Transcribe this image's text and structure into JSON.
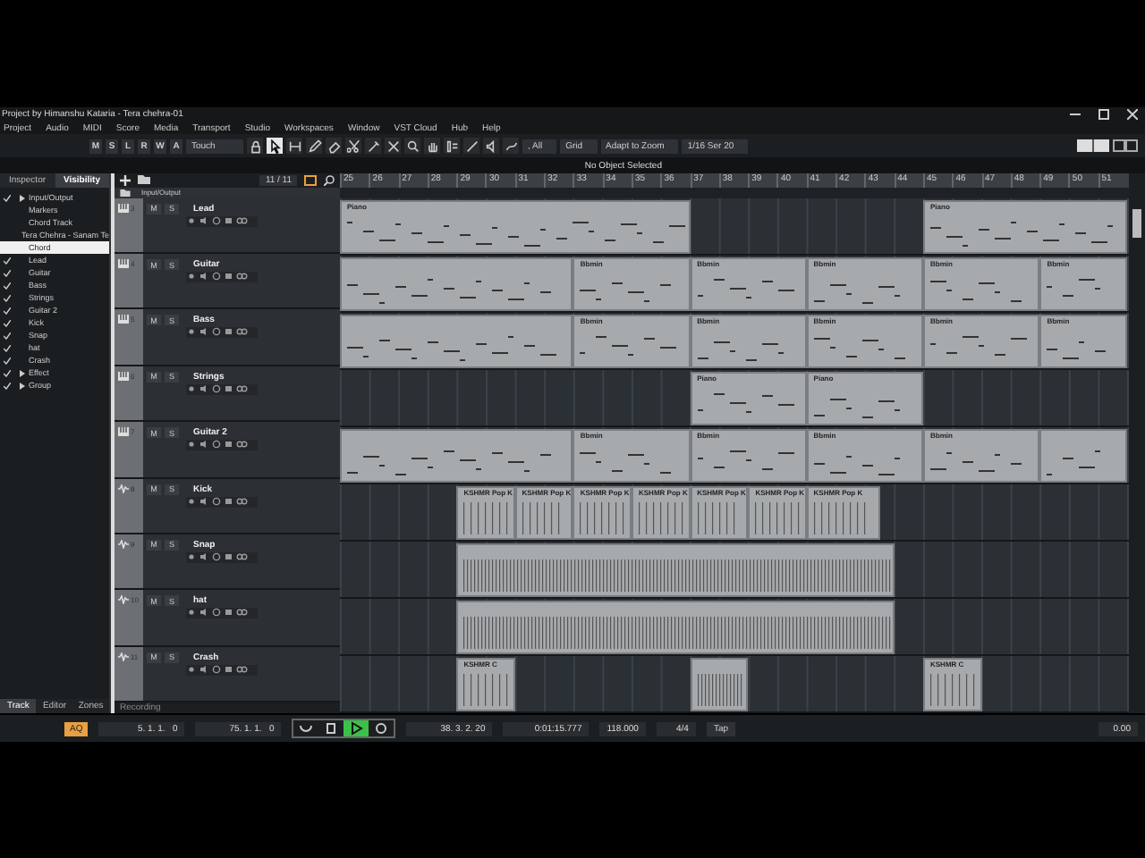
{
  "window": {
    "title": "Project by Himanshu Kataria - Tera chehra-01"
  },
  "menu": [
    "Project",
    "Audio",
    "MIDI",
    "Score",
    "Media",
    "Transport",
    "Studio",
    "Workspaces",
    "Window",
    "VST Cloud",
    "Hub",
    "Help"
  ],
  "toolbar": {
    "modes": [
      "M",
      "S",
      "L",
      "R",
      "W",
      "A"
    ],
    "automation_mode": "Touch",
    "tools": [
      {
        "kind": "lock",
        "selected": false
      },
      {
        "kind": "cursor",
        "selected": true
      },
      {
        "kind": "range",
        "selected": false
      },
      {
        "kind": "pencil",
        "selected": false
      },
      {
        "kind": "eraser",
        "selected": false
      },
      {
        "kind": "scissors",
        "selected": false
      },
      {
        "kind": "glue",
        "selected": false
      },
      {
        "kind": "mute",
        "selected": false
      },
      {
        "kind": "zoom",
        "selected": false
      },
      {
        "kind": "hand",
        "selected": false
      },
      {
        "kind": "comp",
        "selected": false
      },
      {
        "kind": "line",
        "selected": false
      },
      {
        "kind": "speaker",
        "selected": false
      },
      {
        "kind": "warp",
        "selected": false
      }
    ],
    "follow_mode": ", All",
    "snap_type": "Grid",
    "grid": "Adapt to Zoom",
    "quantize": "1/16 Ser 20"
  },
  "info_line": "No Object Selected",
  "left_tabs": [
    {
      "label": "Inspector",
      "selected": false
    },
    {
      "label": "Visibility",
      "selected": true
    }
  ],
  "visibility": [
    {
      "label": "Input/Output",
      "checked": true,
      "folder": true,
      "selected": false
    },
    {
      "label": "Markers",
      "checked": false,
      "folder": false,
      "selected": false
    },
    {
      "label": "Chord Track",
      "checked": false,
      "folder": false,
      "selected": false
    },
    {
      "label": "Tera Chehra - Sanam Te",
      "checked": false,
      "folder": false,
      "selected": false
    },
    {
      "label": "Chord",
      "checked": false,
      "folder": false,
      "selected": true
    },
    {
      "label": "Lead",
      "checked": true,
      "folder": false,
      "selected": false
    },
    {
      "label": "Guitar",
      "checked": true,
      "folder": false,
      "selected": false
    },
    {
      "label": "Bass",
      "checked": true,
      "folder": false,
      "selected": false
    },
    {
      "label": "Strings",
      "checked": true,
      "folder": false,
      "selected": false
    },
    {
      "label": "Guitar 2",
      "checked": true,
      "folder": false,
      "selected": false
    },
    {
      "label": "Kick",
      "checked": true,
      "folder": false,
      "selected": false
    },
    {
      "label": "Snap",
      "checked": true,
      "folder": false,
      "selected": false
    },
    {
      "label": "hat",
      "checked": true,
      "folder": false,
      "selected": false
    },
    {
      "label": "Crash",
      "checked": true,
      "folder": false,
      "selected": false
    },
    {
      "label": "Effect",
      "checked": true,
      "folder": true,
      "selected": false
    },
    {
      "label": "Group",
      "checked": true,
      "folder": true,
      "selected": false
    }
  ],
  "bottom_tabs": [
    {
      "label": "Track",
      "selected": true
    },
    {
      "label": "Editor",
      "selected": false
    },
    {
      "label": "Zones",
      "selected": false
    }
  ],
  "track_count": "11 / 11",
  "folder_track": "Input/Output",
  "ruler": [
    "25",
    "26",
    "27",
    "28",
    "29",
    "30",
    "31",
    "32",
    "33",
    "34",
    "35",
    "36",
    "37",
    "38",
    "39",
    "40",
    "41",
    "42",
    "43",
    "44",
    "45",
    "46",
    "47",
    "48",
    "49",
    "50",
    "51"
  ],
  "tracks": [
    {
      "number": "3",
      "name": "Lead",
      "kind": "midi",
      "mute": "M",
      "solo": "S",
      "clips": [
        {
          "label": "Piano",
          "selected": false
        },
        {
          "label": "Piano",
          "selected": false
        }
      ]
    },
    {
      "number": "4",
      "name": "Guitar",
      "kind": "midi",
      "mute": "M",
      "solo": "S",
      "clips": [
        {
          "selected": false
        },
        {
          "label": "Bbmin",
          "selected": false
        },
        {
          "label": "Bbmin",
          "selected": false
        },
        {
          "label": "Bbmin",
          "selected": false
        },
        {
          "label": "Bbmin",
          "selected": false
        },
        {
          "label": "Bbmin",
          "selected": false
        }
      ]
    },
    {
      "number": "5",
      "name": "Bass",
      "kind": "midi",
      "mute": "M",
      "solo": "S",
      "clips": [
        {
          "selected": false
        },
        {
          "label": "Bbmin",
          "selected": false
        },
        {
          "label": "Bbmin",
          "selected": false
        },
        {
          "label": "Bbmin",
          "selected": false
        },
        {
          "label": "Bbmin",
          "selected": false
        },
        {
          "label": "Bbmin",
          "selected": false
        }
      ]
    },
    {
      "number": "6",
      "name": "Strings",
      "kind": "midi",
      "mute": "M",
      "solo": "S",
      "clips": [
        {
          "label": "Piano",
          "selected": false
        },
        {
          "label": "Piano",
          "selected": false
        }
      ]
    },
    {
      "number": "7",
      "name": "Guitar 2",
      "kind": "midi",
      "mute": "M",
      "solo": "S",
      "clips": [
        {
          "selected": false
        },
        {
          "label": "Bbmin",
          "selected": false
        },
        {
          "label": "Bbmin",
          "selected": false
        },
        {
          "label": "Bbmin",
          "selected": false
        },
        {
          "label": "Bbmin",
          "selected": false
        },
        {
          "selected": false
        }
      ]
    },
    {
      "number": "8",
      "name": "Kick",
      "kind": "audio",
      "mute": "M",
      "solo": "S",
      "clips": [
        {
          "label": "KSHMR Pop K",
          "selected": false
        },
        {
          "label": "KSHMR Pop K",
          "selected": false
        },
        {
          "label": "KSHMR Pop K",
          "selected": false
        },
        {
          "label": "KSHMR Pop K",
          "selected": false
        },
        {
          "label": "KSHMR Pop K",
          "selected": false
        },
        {
          "label": "KSHMR Pop K",
          "selected": false
        },
        {
          "label": "KSHMR Pop K",
          "selected": false
        }
      ]
    },
    {
      "number": "9",
      "name": "Snap",
      "kind": "audio",
      "mute": "M",
      "solo": "S",
      "clips": [
        {
          "selected": false
        }
      ]
    },
    {
      "number": "10",
      "name": "hat",
      "kind": "audio",
      "mute": "M",
      "solo": "S",
      "clips": [
        {
          "selected": false
        }
      ]
    },
    {
      "number": "11",
      "name": "Crash",
      "kind": "audio",
      "mute": "M",
      "solo": "S",
      "clips": [
        {
          "label": "KSHMR C",
          "selected": false
        },
        {
          "selected": false
        },
        {
          "label": "KSHMR C",
          "selected": false
        }
      ]
    }
  ],
  "status": "Recording",
  "transport": {
    "aq": "AQ",
    "left_locator": "5. 1. 1.   0",
    "right_locator": "75. 1. 1.   0",
    "position": "38. 3. 2. 20",
    "time": "0:01:15.777",
    "tempo": "118.000",
    "signature": "4/4",
    "tap": "Tap",
    "volume": "0.00",
    "playing": true
  }
}
